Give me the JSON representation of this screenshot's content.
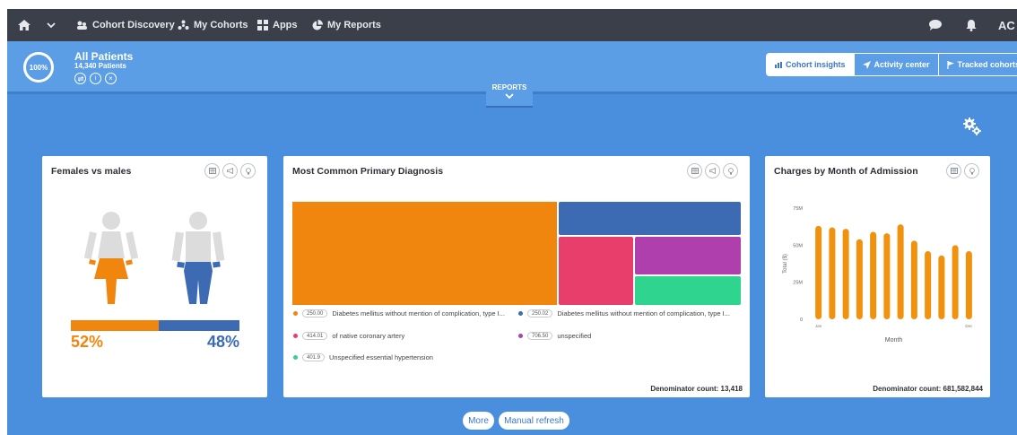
{
  "nav": {
    "items": [
      {
        "label": "Cohort Discovery"
      },
      {
        "label": "My Cohorts"
      },
      {
        "label": "Apps"
      },
      {
        "label": "My Reports"
      }
    ],
    "user_initials": "AC"
  },
  "cohort": {
    "percent": "100%",
    "title": "All Patients",
    "count": "14,340 Patients"
  },
  "insight_tabs": [
    {
      "label": "Cohort insights"
    },
    {
      "label": "Activity center"
    },
    {
      "label": "Tracked cohorts"
    }
  ],
  "reports_label": "REPORTS",
  "cards": {
    "gender": {
      "title": "Females vs males",
      "female_pct_label": "52%",
      "male_pct_label": "48%",
      "female_fraction": 0.52,
      "female_color": "#f0860e",
      "male_color": "#3d6bb3"
    },
    "diagnosis": {
      "title": "Most Common Primary Diagnosis",
      "denominator": "Denominator count: 13,418",
      "legend": [
        {
          "code": "250.00",
          "label": "Diabetes mellitus without mention of complication, type I...",
          "color": "#f0860e"
        },
        {
          "code": "250.02",
          "label": "Diabetes mellitus without mention of complication, type I...",
          "color": "#3d6bb3"
        },
        {
          "code": "414.01",
          "label": "of native coronary artery",
          "color": "#e83e6c"
        },
        {
          "code": "706.50",
          "label": "unspecified",
          "color": "#b03fae"
        },
        {
          "code": "401.9",
          "label": "Unspecified essential hypertension",
          "color": "#2fd48e"
        }
      ]
    },
    "charges": {
      "title": "Charges by Month of Admission",
      "denominator": "Denominator count: 681,582,844"
    }
  },
  "chart_data": {
    "type": "bar",
    "title": "Charges by Month of Admission",
    "xlabel": "Month",
    "ylabel": "Total ($)",
    "y_ticks": [
      "75M",
      "50M",
      "25M",
      "0"
    ],
    "ylim": [
      0,
      75
    ],
    "x_tick_labels": [
      "Jan",
      "Dec"
    ],
    "categories": [
      "Jan",
      "Feb",
      "Mar",
      "Apr",
      "May",
      "Jun",
      "Jul",
      "Aug",
      "Sep",
      "Oct",
      "Nov",
      "Dec"
    ],
    "values": [
      63,
      62,
      61,
      54,
      59,
      58,
      64,
      53,
      46,
      43,
      50,
      46
    ],
    "color": "#f0920e"
  },
  "bottom": {
    "more_label": "More",
    "refresh_label": "Manual refresh"
  }
}
